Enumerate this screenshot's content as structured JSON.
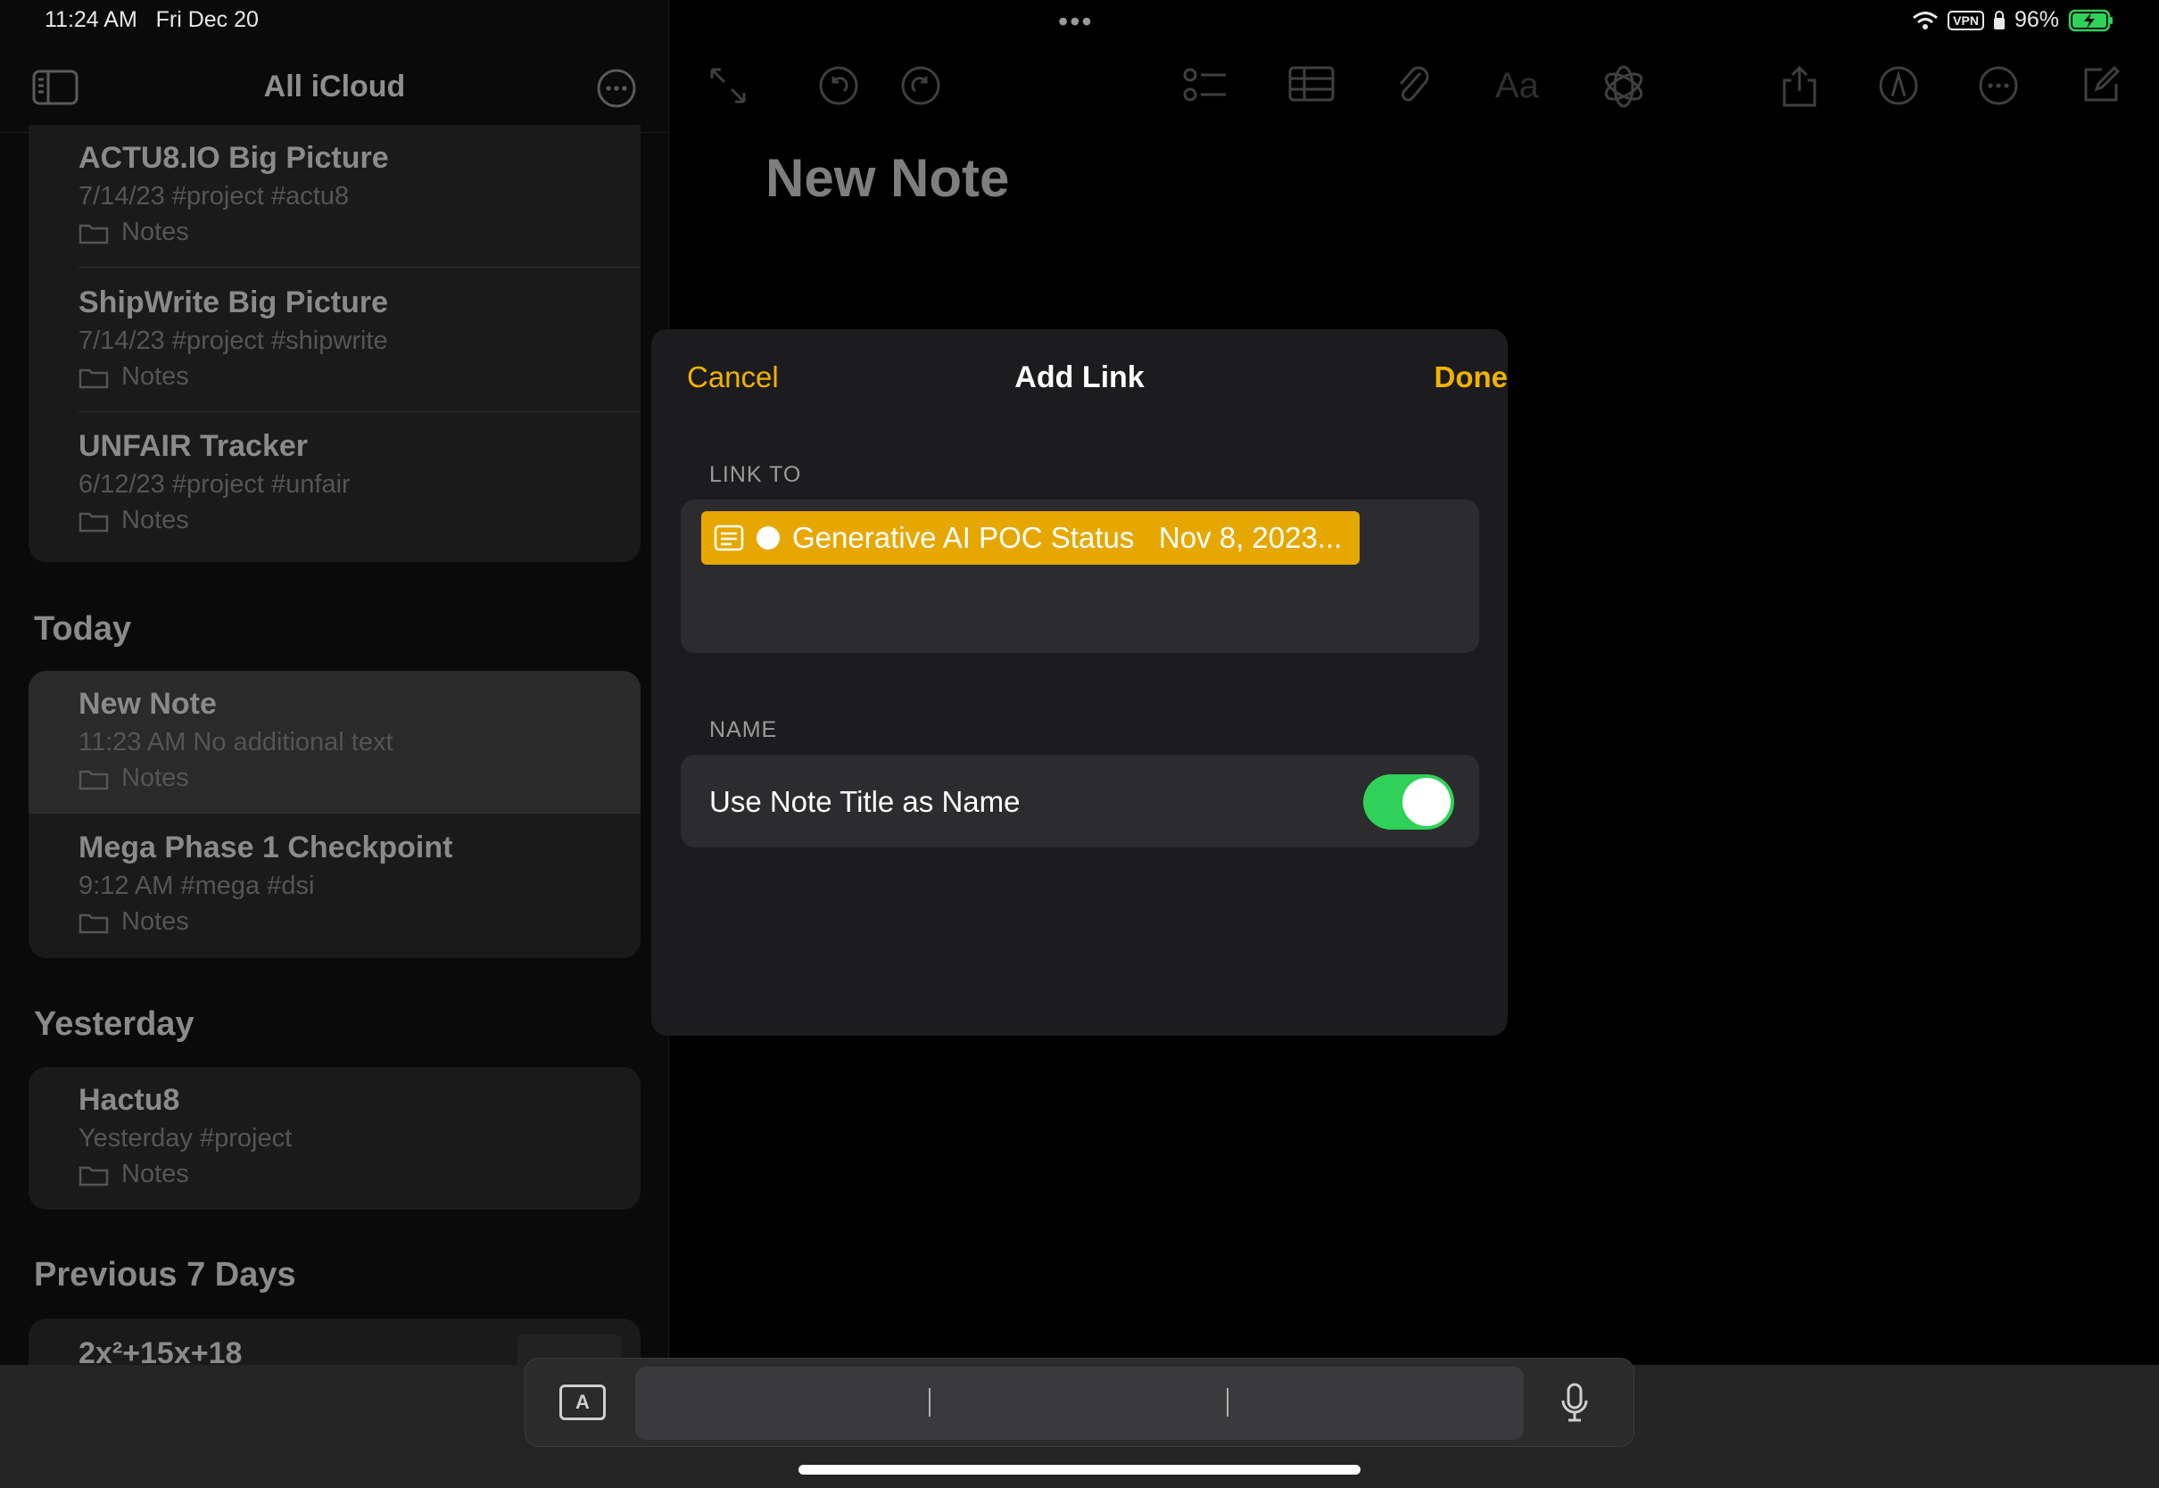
{
  "status_bar": {
    "time": "11:24 AM",
    "date": "Fri Dec 20",
    "vpn": "VPN",
    "battery": "96%"
  },
  "sidebar": {
    "title": "All iCloud",
    "top_group": [
      {
        "title": "ACTU8.IO Big Picture",
        "meta": "7/14/23  #project #actu8",
        "folder": "Notes"
      },
      {
        "title": "ShipWrite Big Picture",
        "meta": "7/14/23  #project #shipwrite",
        "folder": "Notes"
      },
      {
        "title": "UNFAIR Tracker",
        "meta": "6/12/23  #project #unfair",
        "folder": "Notes"
      }
    ],
    "sections": {
      "today": "Today",
      "yesterday": "Yesterday",
      "previous": "Previous 7 Days"
    },
    "today_notes": [
      {
        "title": "New Note",
        "meta": "11:23 AM  No additional text",
        "folder": "Notes"
      },
      {
        "title": "Mega Phase 1 Checkpoint",
        "meta": "9:12 AM  #mega #dsi",
        "folder": "Notes"
      }
    ],
    "yesterday_notes": [
      {
        "title": "Hactu8",
        "meta": "Yesterday  #project",
        "folder": "Notes"
      }
    ],
    "previous_notes": [
      {
        "title": "2x²+15x+18"
      }
    ]
  },
  "editor": {
    "note_title": "New Note"
  },
  "modal": {
    "cancel": "Cancel",
    "title": "Add Link",
    "done": "Done",
    "link_to_label": "LINK TO",
    "link_chip": "Generative AI POC Status   Nov 8, 2023...",
    "name_label": "NAME",
    "use_title_label": "Use Note Title as Name",
    "use_title_enabled": true
  },
  "keyboard_bar": {
    "text_key": "A"
  },
  "colors": {
    "accent": "#f2b200",
    "chip": "#e6a800",
    "toggle_on": "#30d158"
  }
}
